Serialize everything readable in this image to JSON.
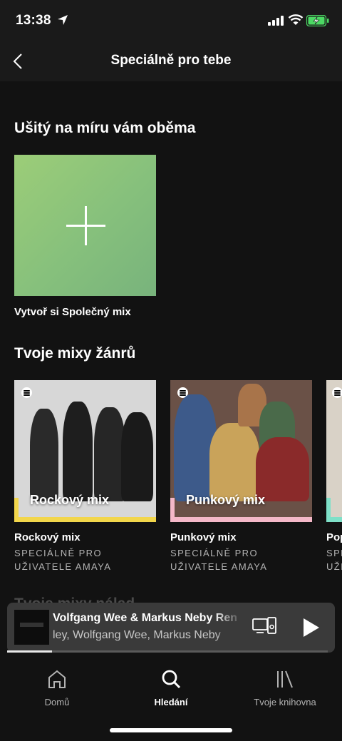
{
  "status_bar": {
    "time": "13:38"
  },
  "header": {
    "title": "Speciálně pro tebe"
  },
  "blend_section": {
    "title": "Ušitý na míru vám oběma",
    "card_caption": "Vytvoř si Společný mix"
  },
  "genre_section": {
    "title": "Tvoje mixy žánrů",
    "mixes": [
      {
        "overlay": "Rockový mix",
        "title": "Rockový mix",
        "subtitle_line1": "SPECIÁLNĚ PRO",
        "subtitle_line2": "UŽIVATELE AMAYA",
        "accent": "#f2d64b"
      },
      {
        "overlay": "Punkový mix",
        "title": "Punkový mix",
        "subtitle_line1": "SPECIÁLNĚ PRO",
        "subtitle_line2": "UŽIVATELE AMAYA",
        "accent": "#f4b8c8"
      },
      {
        "overlay": "",
        "title": "Pop",
        "subtitle_line1": "SPE",
        "subtitle_line2": "UŽI",
        "accent": "#7fe0c8"
      }
    ]
  },
  "next_section": {
    "title": "Tvoje mixy nálad"
  },
  "now_playing": {
    "title": "Volfgang Wee & Markus Neby Ren",
    "artist": "ley, Wolfgang Wee, Markus Neby",
    "progress": 0.14
  },
  "bottom_nav": {
    "items": [
      {
        "label": "Domů",
        "icon": "home-icon",
        "active": false
      },
      {
        "label": "Hledání",
        "icon": "search-icon",
        "active": true
      },
      {
        "label": "Tvoje knihovna",
        "icon": "library-icon",
        "active": false
      }
    ]
  },
  "colors": {
    "background": "#121212",
    "blend_green": "#8fc67a",
    "rock_accent": "#f2d64b",
    "punk_accent": "#f4b8c8"
  }
}
